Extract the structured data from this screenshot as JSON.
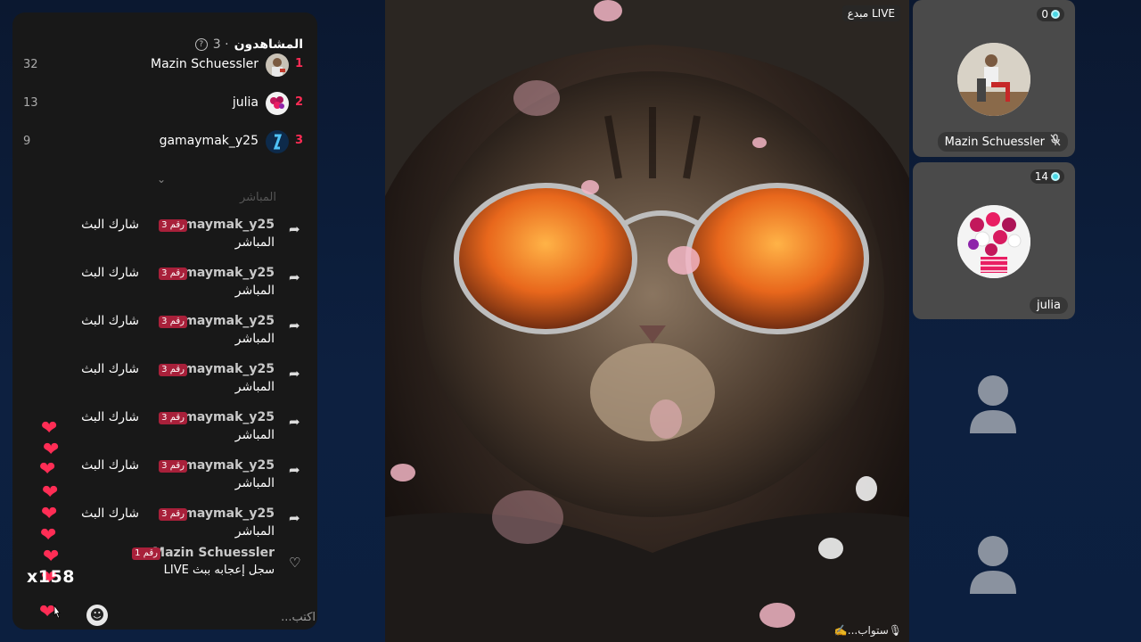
{
  "viewers": {
    "title": "المشاهدون",
    "count": "· 3",
    "list": [
      {
        "rank": "1",
        "name": "Mazin Schuessler",
        "score": "32"
      },
      {
        "rank": "2",
        "name": "julia",
        "score": "13"
      },
      {
        "rank": "3",
        "name": "gamaymak_y25",
        "score": "9"
      }
    ]
  },
  "chat": {
    "faded_line": "المباشر",
    "share_messages": [
      {
        "user": "gamaymak_y25",
        "badge": "رقم 3",
        "text_line1": "شارك البث",
        "text_line2": "المباشر"
      },
      {
        "user": "gamaymak_y25",
        "badge": "رقم 3",
        "text_line1": "شارك البث",
        "text_line2": "المباشر"
      },
      {
        "user": "gamaymak_y25",
        "badge": "رقم 3",
        "text_line1": "شارك البث",
        "text_line2": "المباشر"
      },
      {
        "user": "gamaymak_y25",
        "badge": "رقم 3",
        "text_line1": "شارك البث",
        "text_line2": "المباشر"
      },
      {
        "user": "gamaymak_y25",
        "badge": "رقم 3",
        "text_line1": "شارك البث",
        "text_line2": "المباشر"
      },
      {
        "user": "gamaymak_y25",
        "badge": "رقم 3",
        "text_line1": "شارك البث",
        "text_line2": "المباشر"
      },
      {
        "user": "gamaymak_y25",
        "badge": "رقم 3",
        "text_line1": "شارك البث",
        "text_line2": "المباشر"
      }
    ],
    "like_message": {
      "user": "Mazin Schuessler",
      "badge": "رقم 1",
      "text": "سجل إعجابه ببث LIVE"
    }
  },
  "likes": {
    "counter": "x158"
  },
  "composer": {
    "placeholder": "اكتب..."
  },
  "video": {
    "live_tag": "مبدع LIVE",
    "caption": "✍️...ستواب🎙"
  },
  "guests": [
    {
      "name": "Mazin Schuessler",
      "coins": "0"
    },
    {
      "name": "julia",
      "coins": "14"
    }
  ],
  "colors": {
    "accent": "#fe2c55",
    "panel": "#181818",
    "coin": "#4ad9e6"
  }
}
